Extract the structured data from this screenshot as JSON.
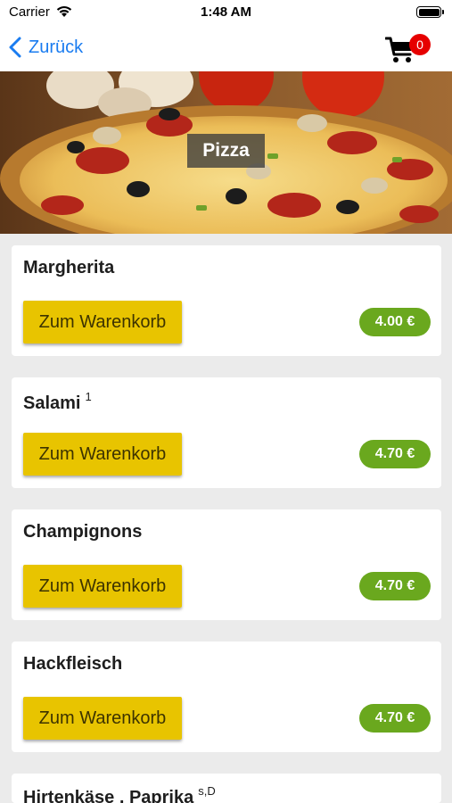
{
  "status_bar": {
    "carrier": "Carrier",
    "time": "1:48 AM"
  },
  "nav": {
    "back_label": "Zurück",
    "cart_count": "0",
    "accent_color": "#1a7cf0",
    "badge_color": "#e60000"
  },
  "hero": {
    "title": "Pizza"
  },
  "products": [
    {
      "name": "Margherita",
      "note": "",
      "button_label": "Zum Warenkorb",
      "price": "4.00 €"
    },
    {
      "name": "Salami",
      "note": "1",
      "button_label": "Zum Warenkorb",
      "price": "4.70 €"
    },
    {
      "name": "Champignons",
      "note": "",
      "button_label": "Zum Warenkorb",
      "price": "4.70 €"
    },
    {
      "name": "Hackfleisch",
      "note": "",
      "button_label": "Zum Warenkorb",
      "price": "4.70 €"
    },
    {
      "name": "Hirtenkäse , Paprika",
      "note": "s,D",
      "button_label": "",
      "price": ""
    }
  ],
  "colors": {
    "button": "#e8c400",
    "price": "#6aa81e",
    "background": "#ebebeb"
  }
}
